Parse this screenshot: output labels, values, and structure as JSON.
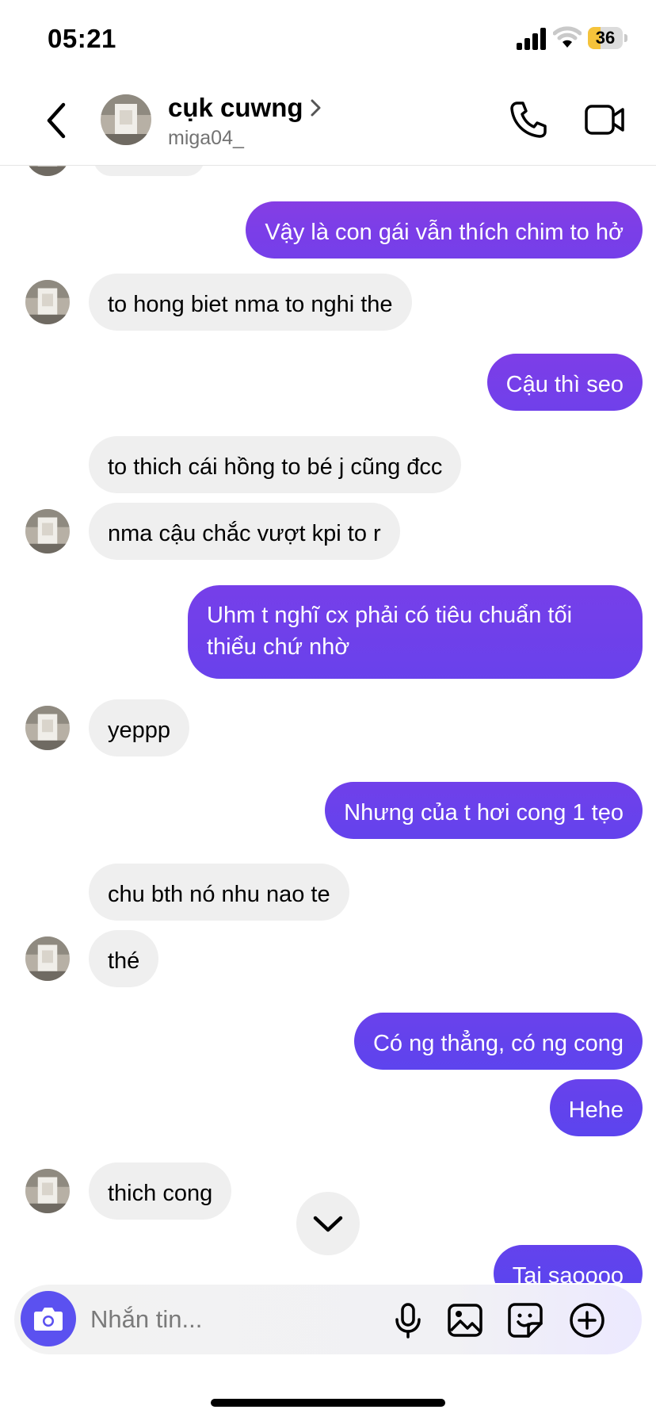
{
  "status_bar": {
    "time": "05:21",
    "battery_level": "36",
    "battery_fraction": 0.36
  },
  "header": {
    "contact_name": "cụk cuwng",
    "username": "miga04_",
    "back_icon": "chevron-left-icon",
    "call_icon": "phone-icon",
    "video_icon": "video-camera-icon"
  },
  "messages": [
    {
      "side": "out",
      "text": "Vậy là con gái vẫn thích chim to hở"
    },
    {
      "side": "in",
      "text": "to hong biet nma to nghi the"
    },
    {
      "side": "out",
      "text": "Cậu thì seo"
    },
    {
      "side": "in",
      "text": "to thich cái hồng to bé j cũng đcc"
    },
    {
      "side": "in",
      "text": "nma cậu chắc vượt kpi to r"
    },
    {
      "side": "out",
      "text": "Uhm t nghĩ cx phải có tiêu chuẩn tối thiểu chứ nhờ"
    },
    {
      "side": "in",
      "text": "yeppp"
    },
    {
      "side": "out",
      "text": "Nhưng của t hơi cong 1 tẹo"
    },
    {
      "side": "in",
      "text": "chu bth nó nhu nao te"
    },
    {
      "side": "in",
      "text": "thé"
    },
    {
      "side": "out",
      "text": "Có ng thẳng, có ng cong"
    },
    {
      "side": "out",
      "text": "Hehe"
    },
    {
      "side": "in",
      "text": "thich cong"
    },
    {
      "side": "out",
      "text": "Tai saoooo"
    }
  ],
  "composer": {
    "placeholder": "Nhắn tin...",
    "camera_icon": "camera-icon",
    "mic_icon": "microphone-icon",
    "gallery_icon": "image-icon",
    "sticker_icon": "sticker-icon",
    "add_icon": "plus-circle-icon"
  },
  "colors": {
    "gradient_top": "#a53bd6",
    "gradient_mid": "#7b3ee8",
    "gradient_bottom": "#5146f0",
    "incoming_bubble": "#efefef",
    "camera_button": "#5b51f0"
  }
}
